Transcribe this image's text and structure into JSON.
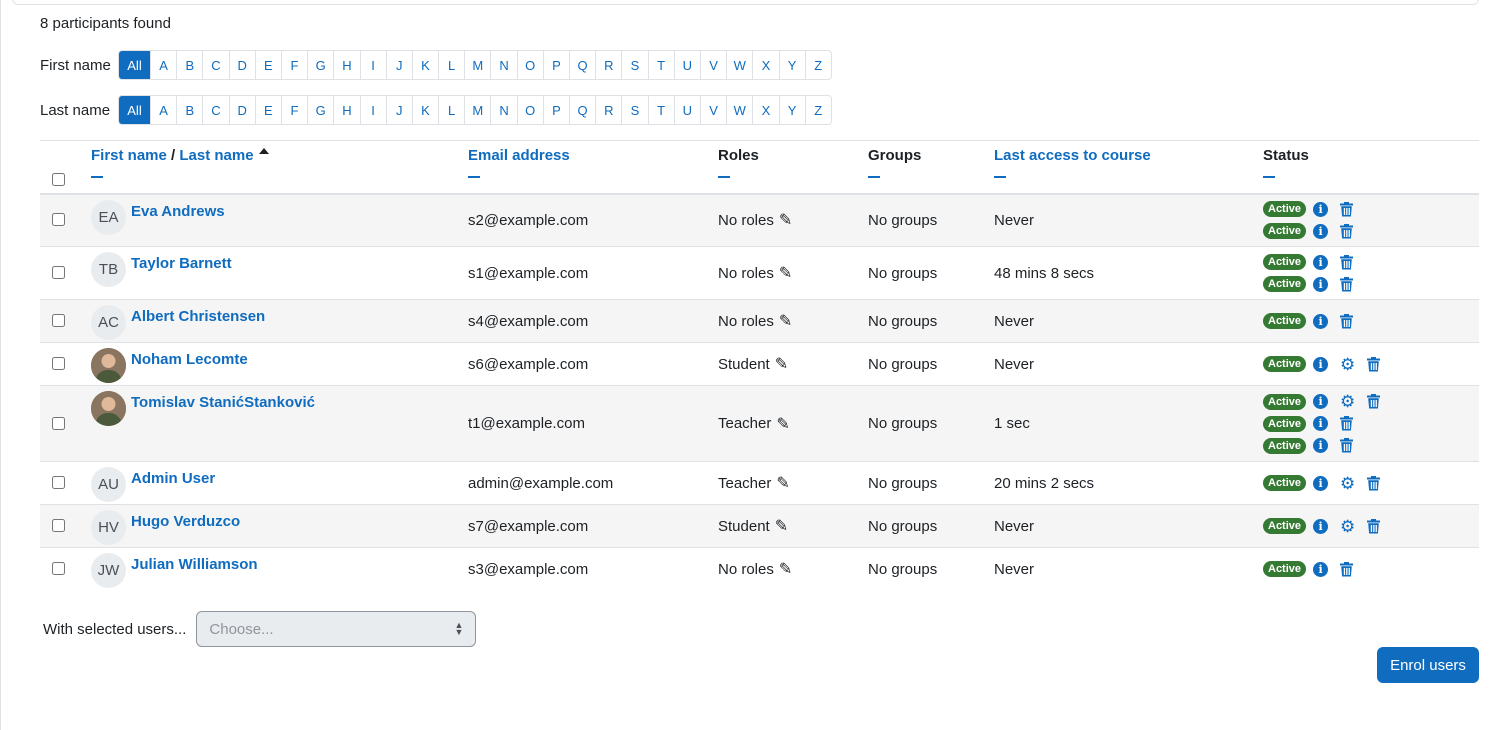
{
  "count_text": "8 participants found",
  "first_initials": {
    "label": "First name",
    "letters": [
      "All",
      "A",
      "B",
      "C",
      "D",
      "E",
      "F",
      "G",
      "H",
      "I",
      "J",
      "K",
      "L",
      "M",
      "N",
      "O",
      "P",
      "Q",
      "R",
      "S",
      "T",
      "U",
      "V",
      "W",
      "X",
      "Y",
      "Z"
    ]
  },
  "last_initials": {
    "label": "Last name",
    "letters": [
      "All",
      "A",
      "B",
      "C",
      "D",
      "E",
      "F",
      "G",
      "H",
      "I",
      "J",
      "K",
      "L",
      "M",
      "N",
      "O",
      "P",
      "Q",
      "R",
      "S",
      "T",
      "U",
      "V",
      "W",
      "X",
      "Y",
      "Z"
    ]
  },
  "headers": {
    "first_name": "First name",
    "sep": " / ",
    "last_name": "Last name",
    "email": "Email address",
    "roles": "Roles",
    "groups": "Groups",
    "last_access": "Last access to course",
    "status": "Status"
  },
  "rows": [
    {
      "initials": "EA",
      "name": "Eva Andrews",
      "email": "s2@example.com",
      "role": "No roles",
      "groups": "No groups",
      "access": "Never",
      "statuses": [
        {
          "badge": "Active",
          "gear": false
        },
        {
          "badge": "Active",
          "gear": false
        }
      ]
    },
    {
      "initials": "TB",
      "name": "Taylor Barnett",
      "email": "s1@example.com",
      "role": "No roles",
      "groups": "No groups",
      "access": "48 mins 8 secs",
      "statuses": [
        {
          "badge": "Active",
          "gear": false
        },
        {
          "badge": "Active",
          "gear": false
        }
      ]
    },
    {
      "initials": "AC",
      "name": "Albert Christensen",
      "email": "s4@example.com",
      "role": "No roles",
      "groups": "No groups",
      "access": "Never",
      "statuses": [
        {
          "badge": "Active",
          "gear": false
        }
      ]
    },
    {
      "initials": "",
      "photo": true,
      "name": "Noham Lecomte",
      "email": "s6@example.com",
      "role": "Student",
      "groups": "No groups",
      "access": "Never",
      "statuses": [
        {
          "badge": "Active",
          "gear": true
        }
      ]
    },
    {
      "initials": "",
      "photo": true,
      "name": "Tomislav StanićStanković",
      "email": "t1@example.com",
      "role": "Teacher",
      "groups": "No groups",
      "access": "1 sec",
      "statuses": [
        {
          "badge": "Active",
          "gear": true
        },
        {
          "badge": "Active",
          "gear": false
        },
        {
          "badge": "Active",
          "gear": false
        }
      ]
    },
    {
      "initials": "AU",
      "name": "Admin User",
      "email": "admin@example.com",
      "role": "Teacher",
      "groups": "No groups",
      "access": "20 mins 2 secs",
      "statuses": [
        {
          "badge": "Active",
          "gear": true
        }
      ]
    },
    {
      "initials": "HV",
      "name": "Hugo Verduzco",
      "email": "s7@example.com",
      "role": "Student",
      "groups": "No groups",
      "access": "Never",
      "statuses": [
        {
          "badge": "Active",
          "gear": true
        }
      ]
    },
    {
      "initials": "JW",
      "name": "Julian Williamson",
      "email": "s3@example.com",
      "role": "No roles",
      "groups": "No groups",
      "access": "Never",
      "statuses": [
        {
          "badge": "Active",
          "gear": false
        }
      ]
    }
  ],
  "bulk": {
    "label": "With selected users...",
    "placeholder": "Choose..."
  },
  "enrol_label": "Enrol users",
  "colors": {
    "primary": "#0f6cbf",
    "badge_active": "#357a32"
  }
}
